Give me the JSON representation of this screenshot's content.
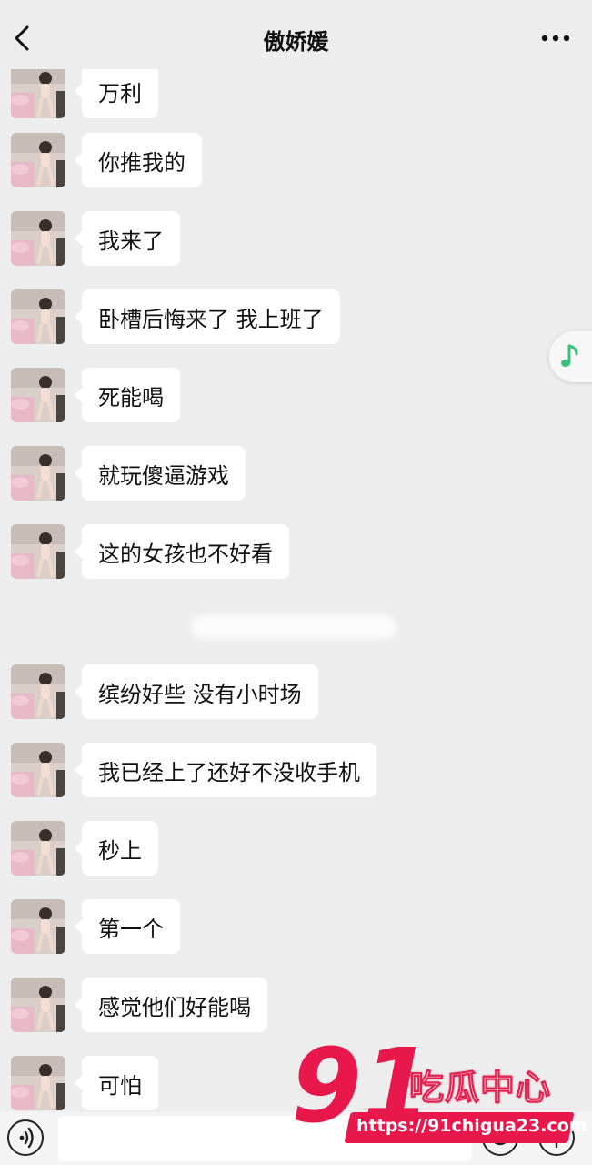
{
  "header": {
    "title": "傲娇媛",
    "back_icon": "chevron-left-icon",
    "more_icon": "more-dots-icon"
  },
  "messages": [
    {
      "text": "万利"
    },
    {
      "text": "你推我的"
    },
    {
      "text": "我来了"
    },
    {
      "text": "卧槽后悔来了 我上班了"
    },
    {
      "text": "死能喝"
    },
    {
      "text": "就玩傻逼游戏"
    },
    {
      "text": "这的女孩也不好看"
    },
    {
      "text": "缤纷好些 没有小时场"
    },
    {
      "text": "我已经上了还好不没收手机"
    },
    {
      "text": "秒上"
    },
    {
      "text": "第一个"
    },
    {
      "text": "感觉他们好能喝"
    },
    {
      "text": "可怕"
    }
  ],
  "floating": {
    "icon": "music-note-icon",
    "color": "#39c27c"
  },
  "input_bar": {
    "value": "",
    "voice_icon": "voice-icon",
    "emoji_icon": "emoji-icon",
    "plus_icon": "plus-icon"
  },
  "watermark": {
    "logo_number": "91",
    "brand": "吃瓜中心",
    "url": "https://91chigua23.com",
    "color": "#e8174c"
  }
}
